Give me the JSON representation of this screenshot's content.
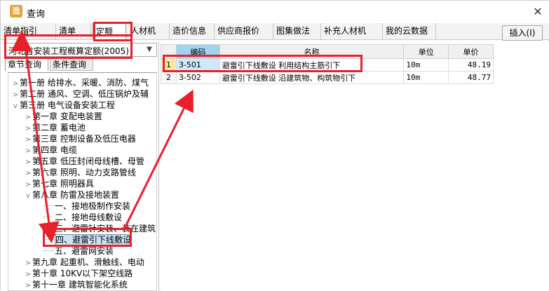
{
  "window": {
    "title": "查询",
    "close_glyph": "✕",
    "icon_glyph": "造"
  },
  "tabs": [
    {
      "label": "清单指引"
    },
    {
      "label": "清单"
    },
    {
      "label": "定额"
    },
    {
      "label": "人材机"
    },
    {
      "label": "造价信息"
    },
    {
      "label": "供应商报价"
    },
    {
      "label": "图集做法"
    },
    {
      "label": "补充人材机"
    },
    {
      "label": "我的云数据"
    }
  ],
  "insert_button": "插入(I)",
  "quota_library": {
    "selected": "河北省安装工程概算定额(2005)"
  },
  "subtabs": [
    {
      "label": "章节查询"
    },
    {
      "label": "条件查询"
    }
  ],
  "tree": [
    {
      "label": "第一册 给排水、采暖、消防、煤气"
    },
    {
      "label": "第二册 通风、空调、低压锅炉及辅"
    },
    {
      "label": "第三册 电气设备安装工程"
    },
    {
      "label": "第一章 变配电装置"
    },
    {
      "label": "第二章 蓄电池"
    },
    {
      "label": "第三章 控制设备及低压电器"
    },
    {
      "label": "第四章 电缆"
    },
    {
      "label": "第五章 低压封闭母线槽、母管"
    },
    {
      "label": "第六章 照明、动力支路管线"
    },
    {
      "label": "第七章 照明器具"
    },
    {
      "label": "第八章 防雷及接地装置"
    },
    {
      "label": "一、接地极制作安装"
    },
    {
      "label": "二、接地母线敷设"
    },
    {
      "label": "三、避雷针安装、装在建筑"
    },
    {
      "label": "四、避雷引下线敷设"
    },
    {
      "label": "五、避雷网安装"
    },
    {
      "label": "第九章 起重机、滑触线、电动"
    },
    {
      "label": "第十章 10KV以下架空线路"
    },
    {
      "label": "第十一章 建筑智能化系统"
    }
  ],
  "table": {
    "headers": [
      "",
      "编码",
      "名称",
      "单位",
      "单价"
    ],
    "rows": [
      {
        "idx": "1",
        "code": "3-501",
        "name": "避雷引下线敷设 利用结构主筋引下",
        "unit": "10m",
        "price": "48.19"
      },
      {
        "idx": "2",
        "code": "3-502",
        "name": "避雷引下线敷设 沿建筑物、构筑物引下",
        "unit": "10m",
        "price": "48.77"
      }
    ]
  },
  "annotation_color": "#e8202a"
}
